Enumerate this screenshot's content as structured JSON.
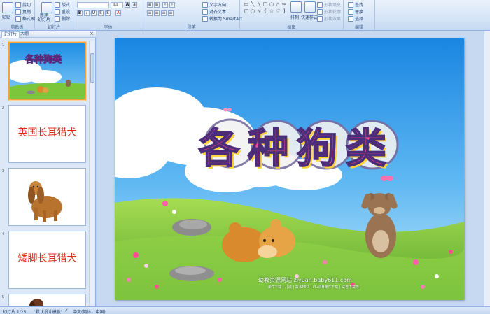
{
  "ribbon": {
    "clipboard": {
      "group_label": "剪贴板",
      "paste": "粘贴",
      "cut": "剪切",
      "copy": "复制",
      "format_painter": "格式刷"
    },
    "slides": {
      "group_label": "幻灯片",
      "new_slide": "新建\n幻灯片",
      "layout": "版式",
      "reset": "重设",
      "delete": "删除"
    },
    "font": {
      "group_label": "字体",
      "font_size": "44"
    },
    "paragraph": {
      "group_label": "段落",
      "text_direction": "文字方向",
      "align_text": "对齐文本",
      "smartart": "转换为 SmartArt"
    },
    "drawing": {
      "group_label": "绘图",
      "arrange": "排列",
      "quick_styles": "快速样式",
      "shape_fill": "形状填充",
      "shape_outline": "形状轮廓",
      "shape_effects": "形状效果"
    },
    "editing": {
      "group_label": "编辑",
      "find": "查找",
      "replace": "替换",
      "select": "选择"
    }
  },
  "pane": {
    "tab_slides": "幻灯片",
    "tab_outline": "大纲",
    "close": "×",
    "thumbs": [
      {
        "num": "1",
        "title": "各种狗类"
      },
      {
        "num": "2",
        "text": "英国长耳猎犬"
      },
      {
        "num": "3",
        "image": "spaniel-dog"
      },
      {
        "num": "4",
        "text": "矮脚长耳猎犬"
      },
      {
        "num": "5",
        "image": "dog-partial"
      }
    ]
  },
  "slide": {
    "title": "各种狗类",
    "watermark_line1": "幼教资源网站  ziyuan.baby611.com",
    "watermark_line2": "课件下载 | 儿歌 | 故事MP3 | FLASH课件下载 | 试卷下载等"
  },
  "status": {
    "slide_counter": "幻灯片 1/23",
    "theme": "\"默认设计模板\"",
    "language": "中文(简体，中国)"
  },
  "colors": {
    "title_red": "#e02a1c",
    "sky": "#2f9be8",
    "grass": "#7cc63c",
    "selected_border": "#f3a03b"
  }
}
